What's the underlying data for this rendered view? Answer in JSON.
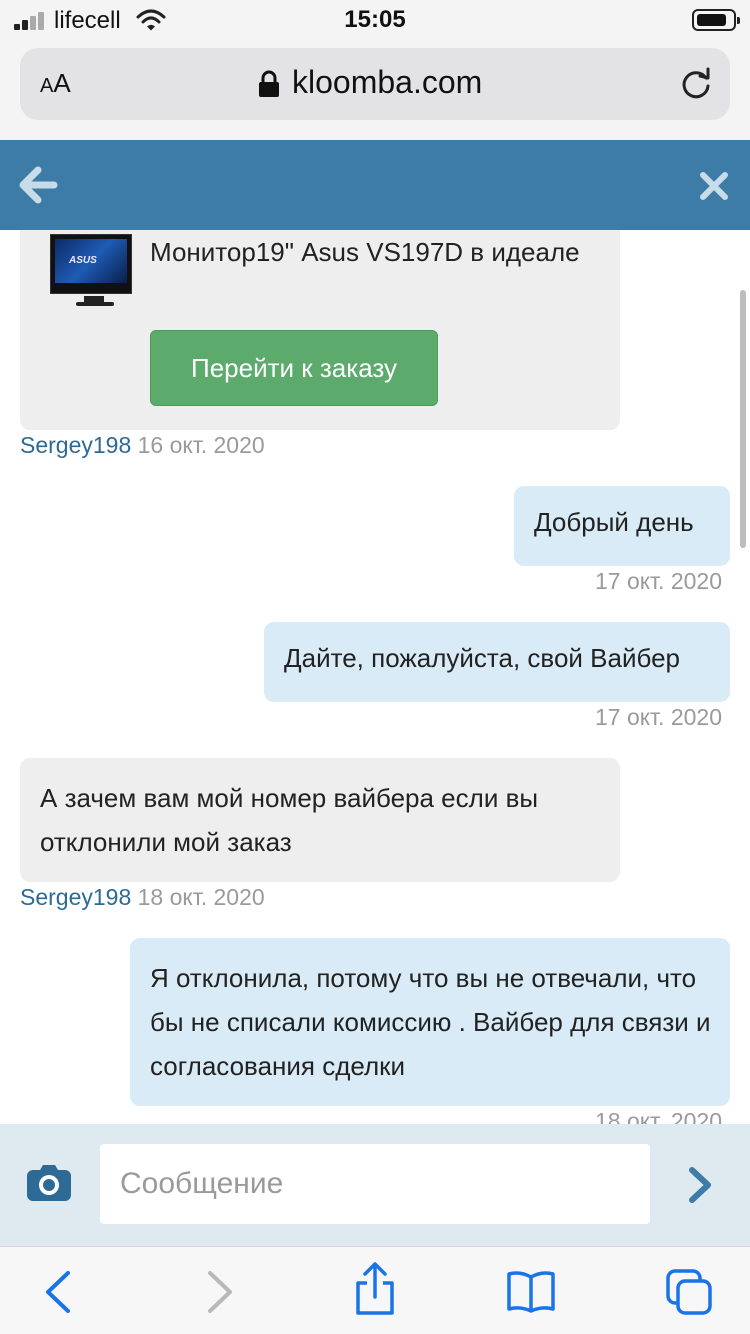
{
  "status_bar": {
    "carrier": "lifecell",
    "time": "15:05"
  },
  "browser": {
    "text_size_small": "A",
    "text_size_large": "A",
    "domain": "kloomba.com"
  },
  "order": {
    "title": "Монитор19\" Asus VS197D в идеале",
    "button_label": "Перейти к заказу",
    "thumbnail_brand": "ASUS"
  },
  "messages": [
    {
      "direction": "in",
      "text": "",
      "user": "Sergey198",
      "date": "16 окт. 2020"
    },
    {
      "direction": "out",
      "text": "Добрый день",
      "date": "17 окт. 2020"
    },
    {
      "direction": "out",
      "text": "Дайте, пожалуйста, свой Вайбер",
      "date": "17 окт. 2020"
    },
    {
      "direction": "in",
      "text": "А зачем вам мой номер вайбера если вы отклонили мой заказ",
      "user": "Sergey198",
      "date": "18 окт. 2020"
    },
    {
      "direction": "out",
      "text": "Я отклонила, потому что вы не отвечали, что бы не списали комиссию . Вайбер для связи и согласования сделки",
      "date": "18 окт. 2020"
    }
  ],
  "composer": {
    "placeholder": "Сообщение"
  },
  "colors": {
    "header": "#3e7ca8",
    "outgoing_bubble": "#d9ebf6",
    "incoming_bubble": "#eeeeee",
    "order_button": "#5caa6c",
    "username": "#2e6a96",
    "toolbar_icon": "#1a73e8"
  },
  "icons": {
    "header_left": "back-arrow-icon",
    "header_right": "close-icon",
    "composer_left": "camera-icon",
    "composer_right": "send-icon",
    "toolbar": [
      "back-icon",
      "forward-icon",
      "share-icon",
      "bookmarks-icon",
      "tabs-icon"
    ]
  }
}
